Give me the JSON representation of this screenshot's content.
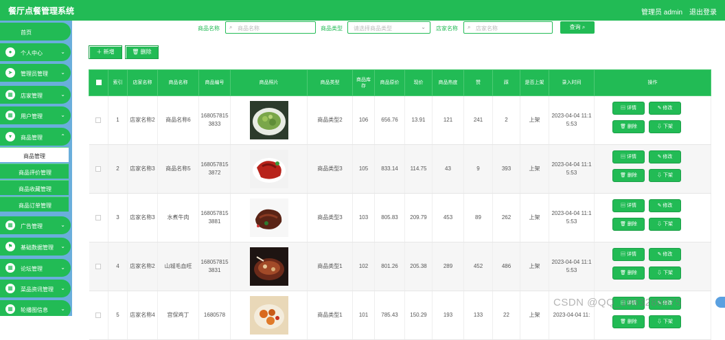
{
  "header": {
    "title": "餐厅点餐管理系统",
    "user": "管理员 admin",
    "logout": "退出登录"
  },
  "sidebar": {
    "items": [
      {
        "label": "首页",
        "icon": "home-icon"
      },
      {
        "label": "个人中心",
        "icon": "user-icon"
      },
      {
        "label": "管理员管理",
        "icon": "send-icon"
      },
      {
        "label": "店家管理",
        "icon": "grid-icon"
      },
      {
        "label": "用户管理",
        "icon": "grid-icon"
      },
      {
        "label": "商品管理",
        "icon": "filter-icon"
      },
      {
        "label": "广告管理",
        "icon": "grid-icon"
      },
      {
        "label": "基础数据管理",
        "icon": "flag-icon"
      },
      {
        "label": "论坛管理",
        "icon": "grid-icon"
      },
      {
        "label": "菜品资讯管理",
        "icon": "grid-icon"
      },
      {
        "label": "轮播图信息",
        "icon": "grid-icon"
      }
    ],
    "sub_items": [
      "商品管理",
      "商品评价管理",
      "商品收藏管理",
      "商品订单管理"
    ]
  },
  "search": {
    "name_label": "商品名称",
    "name_placeholder": "商品名称",
    "type_label": "商品类型",
    "type_placeholder": "请选择商品类型",
    "shop_label": "店家名称",
    "shop_placeholder": "店家名称",
    "button": "查询 ⌕"
  },
  "toolbar": {
    "add": "＋ 新增",
    "delete": "🗑 删除"
  },
  "table": {
    "headers": [
      "",
      "索引",
      "店家名称",
      "商品名称",
      "商品编号",
      "商品照片",
      "商品类型",
      "商品库存",
      "商品原价",
      "现价",
      "商品热度",
      "赞",
      "踩",
      "是否上架",
      "录入时间",
      "操作"
    ],
    "ops": [
      "▤ 详情",
      "✎ 修改",
      "🗑 删除",
      "⇩ 下架"
    ],
    "rows": [
      {
        "idx": "1",
        "shop": "店家名称2",
        "name": "商品名称6",
        "code": "1680578153833",
        "type": "商品类型2",
        "stock": "106",
        "orig": "656.76",
        "now": "13.91",
        "hot": "121",
        "up": "241",
        "down": "2",
        "onsale": "上架",
        "time": "2023-04-04 11:15:53",
        "dish": "salad"
      },
      {
        "idx": "2",
        "shop": "店家名称3",
        "name": "商品名称5",
        "code": "1680578153872",
        "type": "商品类型3",
        "stock": "105",
        "orig": "833.14",
        "now": "114.75",
        "hot": "43",
        "up": "9",
        "down": "393",
        "onsale": "上架",
        "time": "2023-04-04 11:15:53",
        "dish": "redmeat"
      },
      {
        "idx": "3",
        "shop": "店家名称3",
        "name": "水煮牛肉",
        "code": "1680578153881",
        "type": "商品类型3",
        "stock": "103",
        "orig": "805.83",
        "now": "209.79",
        "hot": "453",
        "up": "89",
        "down": "262",
        "onsale": "上架",
        "time": "2023-04-04 11:15:53",
        "dish": "beef"
      },
      {
        "idx": "4",
        "shop": "店家名称2",
        "name": "山城毛血旺",
        "code": "1680578153831",
        "type": "商品类型1",
        "stock": "102",
        "orig": "801.26",
        "now": "205.38",
        "hot": "289",
        "up": "452",
        "down": "486",
        "onsale": "上架",
        "time": "2023-04-04 11:15:53",
        "dish": "stew"
      },
      {
        "idx": "5",
        "shop": "店家名称4",
        "name": "宫保鸡丁",
        "code": "1680578",
        "type": "商品类型1",
        "stock": "101",
        "orig": "785.43",
        "now": "150.29",
        "hot": "193",
        "up": "133",
        "down": "22",
        "onsale": "上架",
        "time": "2023-04-04 11:",
        "dish": "chicken"
      }
    ]
  },
  "watermark": "CSDN @QQ_1963288475"
}
